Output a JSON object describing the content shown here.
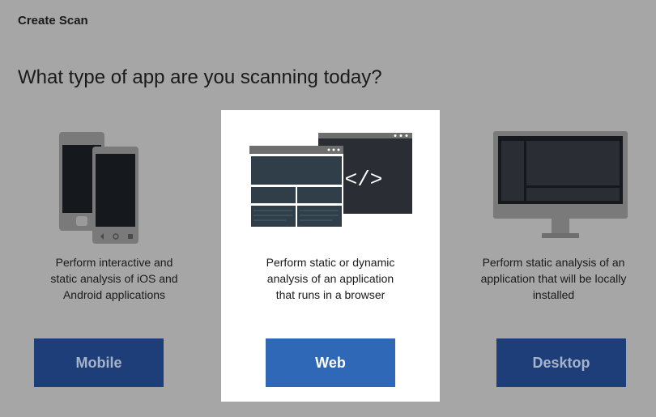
{
  "header": {
    "title": "Create Scan"
  },
  "question": "What type of app are you scanning today?",
  "options": [
    {
      "id": "mobile",
      "icon": "mobile-devices-icon",
      "desc_lines": [
        "Perform interactive and",
        "static analysis of iOS and",
        "Android applications"
      ],
      "button_label": "Mobile",
      "selected": false
    },
    {
      "id": "web",
      "icon": "web-browser-icon",
      "desc_lines": [
        "Perform static or dynamic",
        "analysis of an application",
        "that runs in a browser"
      ],
      "button_label": "Web",
      "selected": true
    },
    {
      "id": "desktop",
      "icon": "desktop-monitor-icon",
      "desc_lines": [
        "Perform static analysis of an",
        "application that will be locally",
        "installed"
      ],
      "button_label": "Desktop",
      "selected": false
    }
  ],
  "colors": {
    "background": "#a6a6a6",
    "selected_card": "#ffffff",
    "button_selected": "#3068b8",
    "button_unselected": "#1d3e78"
  }
}
